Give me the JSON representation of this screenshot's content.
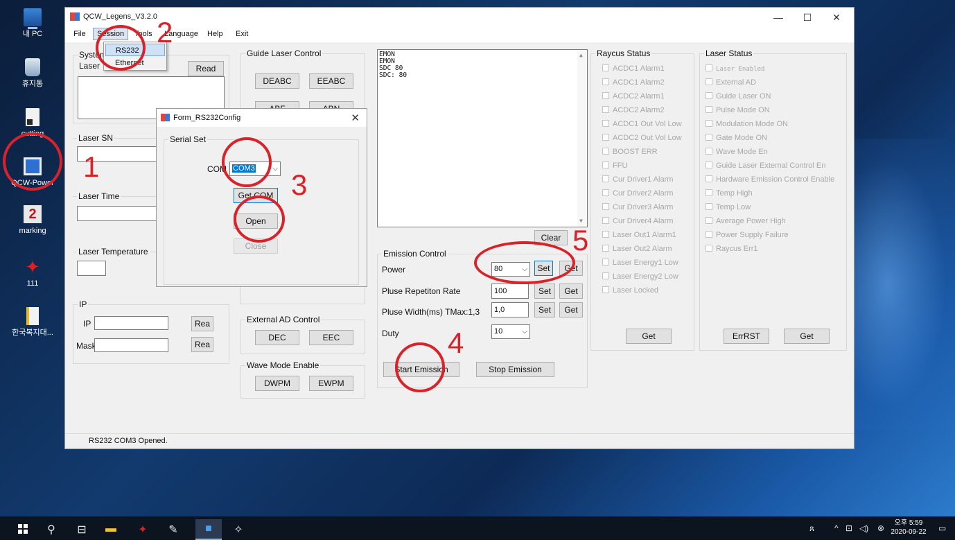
{
  "desktop": {
    "icons": [
      {
        "label": "내 PC",
        "icon": "computer-icon"
      },
      {
        "label": "휴지통",
        "icon": "recycle-bin-icon"
      },
      {
        "label": "cutting",
        "icon": "file-icon"
      },
      {
        "label": "QCW-Power",
        "icon": "app-icon"
      },
      {
        "label": "marking",
        "icon": "marking-icon"
      },
      {
        "label": "111",
        "icon": "star-icon"
      },
      {
        "label": "한국복지대...",
        "icon": "document-icon"
      }
    ]
  },
  "window": {
    "title": "QCW_Legens_V3.2.0",
    "controls": {
      "minimize": "—",
      "maximize": "☐",
      "close": "✕"
    },
    "menu": [
      "File",
      "Session",
      "Tools",
      "Language",
      "Help",
      "Exit"
    ],
    "session_menu": {
      "items": [
        "RS232",
        "Ethernet"
      ]
    }
  },
  "system_group": {
    "title": "System",
    "laser_label": "Laser",
    "read_button": "Read",
    "laser_sn_label": "Laser SN",
    "laser_time_label": "Laser Time",
    "laser_temp_label": "Laser Temperature",
    "ip_group": "IP",
    "ip_label": "IP",
    "mask_label": "Mask",
    "ip_read_button": "Rea",
    "mask_read_button": "Rea"
  },
  "guide_laser": {
    "title": "Guide Laser Control",
    "buttons": [
      "DEABC",
      "EEABC",
      "ABF",
      "ABN"
    ]
  },
  "external_ad": {
    "title": "External AD Control",
    "buttons": [
      "DEC",
      "EEC"
    ]
  },
  "wave_mode": {
    "title": "Wave Mode Enable",
    "buttons": [
      "DWPM",
      "EWPM"
    ]
  },
  "log": {
    "lines": [
      "EMON",
      "EMON",
      "SDC 80",
      "SDC: 80"
    ],
    "clear_button": "Clear"
  },
  "emission": {
    "title": "Emission Control",
    "power_label": "Power",
    "power_value": "80",
    "prr_label": "Pluse Repetiton Rate",
    "prr_value": "100",
    "pw_label": "Pluse Width(ms) TMax:1,3",
    "pw_value": "1,0",
    "duty_label": "Duty",
    "duty_value": "10",
    "set_label": "Set",
    "get_label": "Get",
    "start_button": "Start Emission",
    "stop_button": "Stop Emission"
  },
  "raycus_status": {
    "title": "Raycus Status",
    "items": [
      "ACDC1 Alarm1",
      "ACDC1 Alarm2",
      "ACDC2 Alarm1",
      "ACDC2 Alarm2",
      "ACDC1 Out Vol Low",
      "ACDC2 Out Vol Low",
      "BOOST ERR",
      "FFU",
      "Cur Driver1 Alarm",
      "Cur Driver2 Alarm",
      "Cur Driver3 Alarm",
      "Cur Driver4 Alarm",
      "Laser Out1 Alarm1",
      "Laser Out2 Alarm",
      "Laser Energy1 Low",
      "Laser Energy2 Low",
      "Laser Locked"
    ],
    "get_button": "Get"
  },
  "laser_status": {
    "title": "Laser Status",
    "items": [
      "Laser Enabled",
      "External AD",
      "Guide Laser ON",
      "Pulse Mode ON",
      "Modulation Mode ON",
      "Gate Mode ON",
      "Wave Mode En",
      "Guide Laser External Control En",
      "Hardware Emission Control Enable",
      "Temp High",
      "Temp Low",
      "Average Power High",
      "Power Supply Failure",
      "Raycus Err1"
    ],
    "errrst_button": "ErrRST",
    "get_button": "Get"
  },
  "status_bar": {
    "text": "RS232 COM3 Opened."
  },
  "dialog": {
    "title": "Form_RS232Config",
    "close": "✕",
    "group_title": "Serial Set",
    "com_label": "COM",
    "com_value": "COM3",
    "get_com_button": "Get COM",
    "open_button": "Open",
    "close_button": "Close"
  },
  "annotations": [
    "1",
    "2",
    "3",
    "4",
    "5"
  ],
  "taskbar": {
    "clock_time": "오후 5:59",
    "clock_date": "2020-09-22"
  },
  "colors": {
    "annotation": "#d8232a",
    "accent": "#0078d7",
    "taskbar": "#0c1420"
  }
}
